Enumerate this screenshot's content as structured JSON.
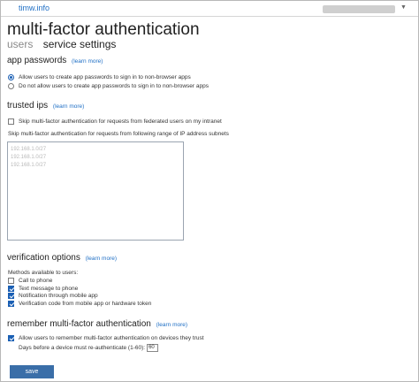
{
  "header": {
    "brand": "timw.info"
  },
  "page": {
    "title": "multi-factor authentication",
    "tabs": [
      {
        "label": "users",
        "active": false
      },
      {
        "label": "service settings",
        "active": true
      }
    ]
  },
  "app_passwords": {
    "heading": "app passwords",
    "learn_more": "(learn more)",
    "options": [
      {
        "label": "Allow users to create app passwords to sign in to non-browser apps",
        "selected": true
      },
      {
        "label": "Do not allow users to create app passwords to sign in to non-browser apps",
        "selected": false
      }
    ]
  },
  "trusted_ips": {
    "heading": "trusted ips",
    "learn_more": "(learn more)",
    "skip_federated": {
      "label": "Skip multi-factor authentication for requests from federated users on my intranet",
      "checked": false
    },
    "range_label": "Skip multi-factor authentication for requests from following range of IP address subnets",
    "subnets": [
      "192.168.1.0/27",
      "192.168.1.0/27",
      "192.168.1.0/27"
    ]
  },
  "verification": {
    "heading": "verification options",
    "learn_more": "(learn more)",
    "methods_label": "Methods available to users:",
    "methods": [
      {
        "label": "Call to phone",
        "checked": false
      },
      {
        "label": "Text message to phone",
        "checked": true
      },
      {
        "label": "Notification through mobile app",
        "checked": true
      },
      {
        "label": "Verification code from mobile app or hardware token",
        "checked": true
      }
    ]
  },
  "remember": {
    "heading": "remember multi-factor authentication",
    "learn_more": "(learn more)",
    "allow": {
      "label": "Allow users to remember multi-factor authentication on devices they trust",
      "checked": true
    },
    "days_label": "Days before a device must re-authenticate (1-60):",
    "days_value": "60"
  },
  "actions": {
    "save_label": "save"
  },
  "colors": {
    "accent": "#1a5fb4",
    "link": "#1f6fc5",
    "button": "#3a6ea8"
  }
}
